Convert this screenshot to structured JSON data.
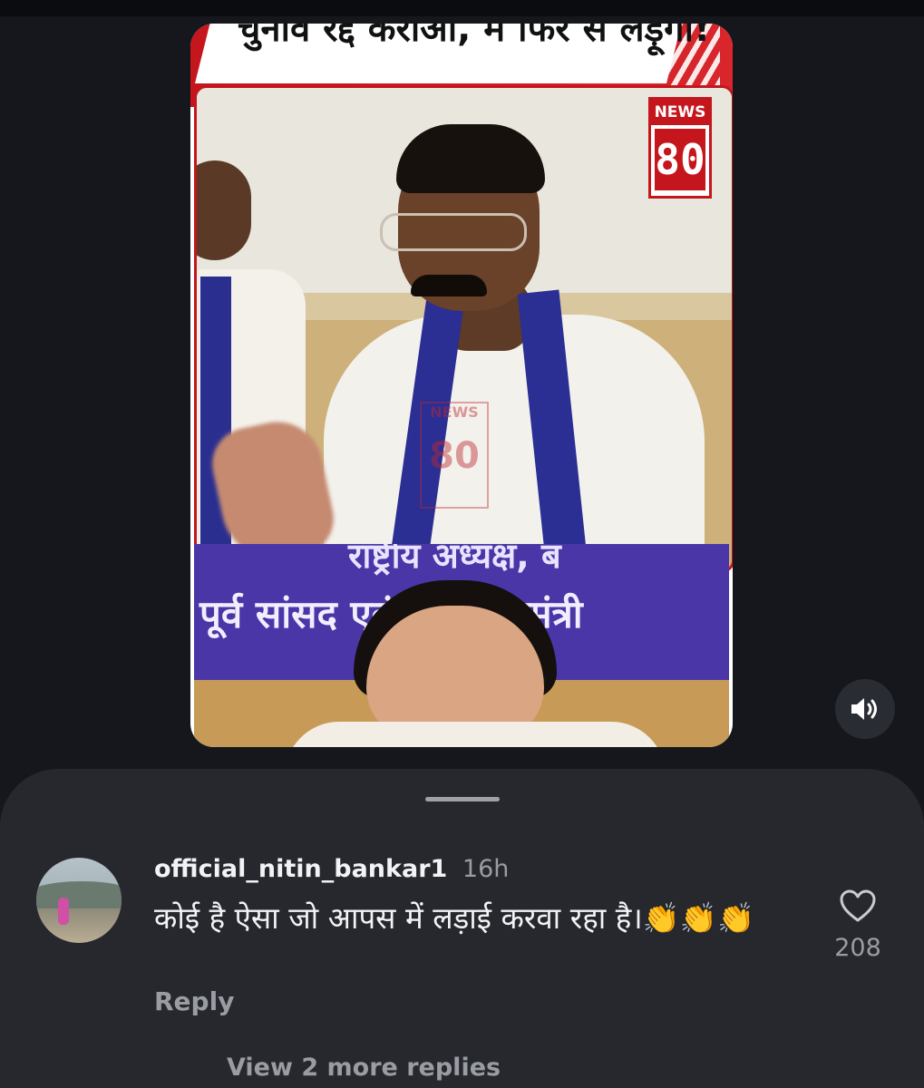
{
  "video": {
    "headline": "चुनाव रद्द कराओ, मैं फिर से लड़ूंगा!",
    "logo_top": "NEWS",
    "logo_num": "80",
    "watermark_top": "NEWS",
    "watermark_num": "80",
    "banner_line1": "राष्ट्रीय अध्यक्ष, ब",
    "banner_line2": "पूर्व सांसद एवं पूर्व मुख्यमंत्री",
    "sound_icon": "speaker-icon"
  },
  "comment": {
    "username": "official_nitin_bankar1",
    "time": "16h",
    "text": "कोई है ऐसा जो आपस में लड़ाई करवा रहा है।👏👏👏",
    "reply_label": "Reply",
    "like_count": "208",
    "more_replies_label": "View 2 more replies"
  },
  "colors": {
    "background": "#15171c",
    "sheet": "#26282e",
    "news_red": "#c4161c",
    "stole_blue": "#2b2e93",
    "banner_purple": "#4b36a8",
    "muted_text": "#9a9ca3"
  }
}
